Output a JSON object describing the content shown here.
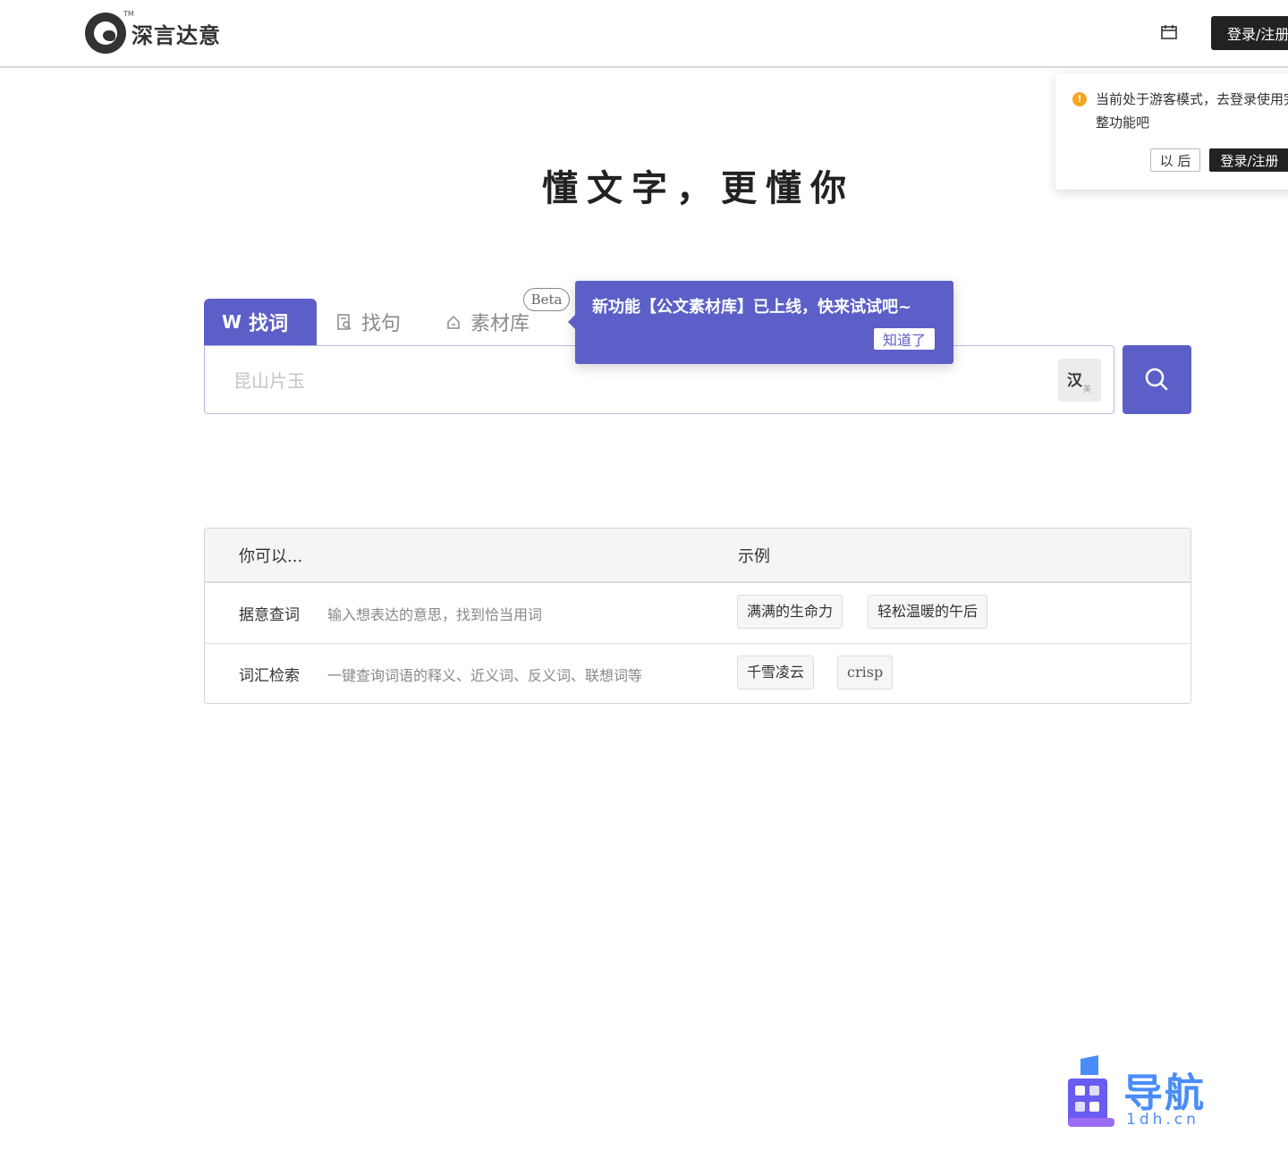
{
  "header": {
    "brand_name": "深言达意",
    "brand_tm": "TM",
    "calendar_icon": "calendar-icon",
    "login_label": "登录/注册"
  },
  "guest_notice": {
    "message": "当前处于游客模式，去登录使用完整功能吧",
    "later_label": "以 后",
    "login_label": "登录/注册",
    "icon": "warning-icon"
  },
  "hero": {
    "slogan": "懂文字，更懂你"
  },
  "tabs": [
    {
      "label": "找词",
      "icon": "word-icon"
    },
    {
      "label": "找句",
      "icon": "sentence-icon"
    },
    {
      "label": "素材库",
      "icon": "material-icon",
      "badge": "Beta"
    }
  ],
  "search": {
    "placeholder": "昆山片玉",
    "lang_toggle_main": "汉",
    "lang_toggle_sub": "英",
    "button_icon": "search-icon"
  },
  "tooltip": {
    "text": "新功能【公文素材库】已上线，快来试试吧~",
    "ok_label": "知道了"
  },
  "features": {
    "header_left": "你可以...",
    "header_right": "示例",
    "rows": [
      {
        "name": "据意查词",
        "desc": "输入想表达的意思，找到恰当用词",
        "examples": [
          "满满的生命力",
          "轻松温暖的午后"
        ]
      },
      {
        "name": "词汇检索",
        "desc": "一键查询词语的释义、近义词、反义词、联想词等",
        "examples": [
          "千雪凌云",
          "crisp"
        ]
      }
    ]
  },
  "watermark": {
    "text": "导航",
    "sub": "1dh.cn"
  },
  "colors": {
    "accent": "#5b5fc7",
    "dark": "#222222",
    "warning": "#f5a623"
  }
}
